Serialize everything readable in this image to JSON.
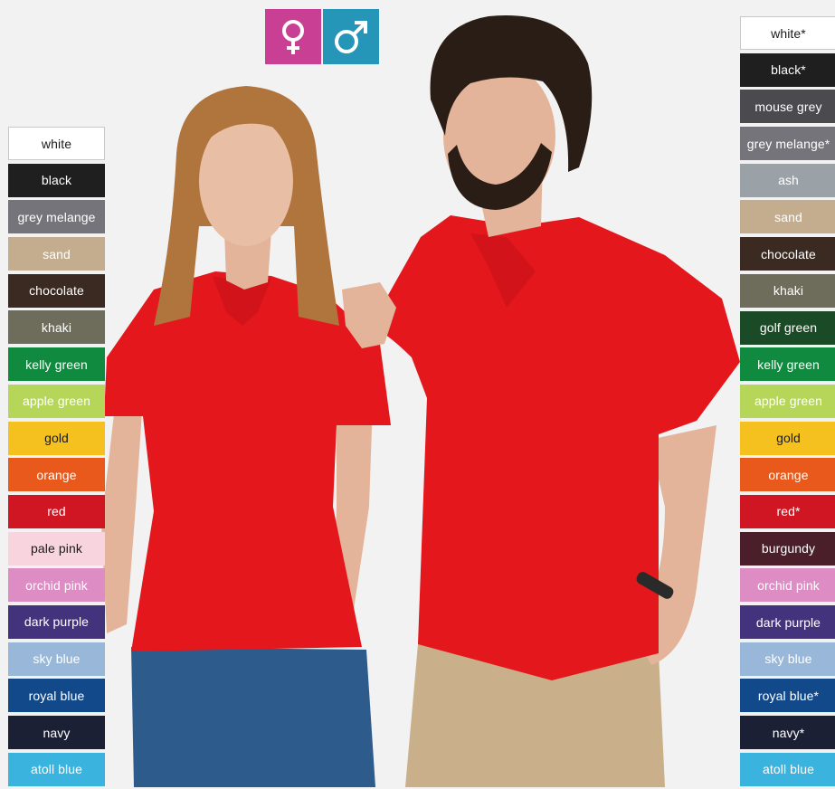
{
  "gender_icons": [
    {
      "name": "female",
      "color": "#c83f93"
    },
    {
      "name": "male",
      "color": "#2596b7"
    }
  ],
  "left_colors": [
    {
      "label": "white",
      "color": "#ffffff",
      "text": "#1a1a1a"
    },
    {
      "label": "black",
      "color": "#1f1f1f"
    },
    {
      "label": "grey melange",
      "color": "#75747a"
    },
    {
      "label": "sand",
      "color": "#c4ad8f"
    },
    {
      "label": "chocolate",
      "color": "#3a2a22"
    },
    {
      "label": "khaki",
      "color": "#6e6d5c"
    },
    {
      "label": "kelly green",
      "color": "#0f8a3e"
    },
    {
      "label": "apple green",
      "color": "#b6d659"
    },
    {
      "label": "gold",
      "color": "#f4c11f",
      "text": "#1a1a1a"
    },
    {
      "label": "orange",
      "color": "#e8591b"
    },
    {
      "label": "red",
      "color": "#d11623"
    },
    {
      "label": "pale pink",
      "color": "#f7d4de",
      "text": "#1a1a1a"
    },
    {
      "label": "orchid pink",
      "color": "#dd8cc4"
    },
    {
      "label": "dark purple",
      "color": "#43337c"
    },
    {
      "label": "sky blue",
      "color": "#99b8d9"
    },
    {
      "label": "royal blue",
      "color": "#12498b"
    },
    {
      "label": "navy",
      "color": "#1c2035"
    },
    {
      "label": "atoll blue",
      "color": "#3ab4df"
    }
  ],
  "right_colors": [
    {
      "label": "white*",
      "color": "#ffffff",
      "text": "#1a1a1a"
    },
    {
      "label": "black*",
      "color": "#1f1f1f"
    },
    {
      "label": "mouse grey",
      "color": "#4a4a4f"
    },
    {
      "label": "grey melange*",
      "color": "#75747a"
    },
    {
      "label": "ash",
      "color": "#9aa2a8"
    },
    {
      "label": "sand",
      "color": "#c4ad8f"
    },
    {
      "label": "chocolate",
      "color": "#3a2a22"
    },
    {
      "label": "khaki",
      "color": "#6e6d5c"
    },
    {
      "label": "golf green",
      "color": "#1a4a26"
    },
    {
      "label": "kelly green",
      "color": "#0f8a3e"
    },
    {
      "label": "apple green",
      "color": "#b6d659"
    },
    {
      "label": "gold",
      "color": "#f4c11f",
      "text": "#1a1a1a"
    },
    {
      "label": "orange",
      "color": "#e8591b"
    },
    {
      "label": "red*",
      "color": "#d11623"
    },
    {
      "label": "burgundy",
      "color": "#4b1f2a"
    },
    {
      "label": "orchid pink",
      "color": "#dd8cc4"
    },
    {
      "label": "dark purple",
      "color": "#43337c"
    },
    {
      "label": "sky blue",
      "color": "#99b8d9"
    },
    {
      "label": "royal blue*",
      "color": "#12498b"
    },
    {
      "label": "navy*",
      "color": "#1c2035"
    },
    {
      "label": "atoll blue",
      "color": "#3ab4df"
    }
  ],
  "photo": {
    "shirt_color": "#e3171c",
    "jeans_color": "#2d5b8c",
    "chinos_color": "#c9b08a",
    "skin_color": "#e3b49a",
    "hair_female": "#b0743d",
    "hair_male": "#2a1d16",
    "background": "#f2f2f2"
  }
}
